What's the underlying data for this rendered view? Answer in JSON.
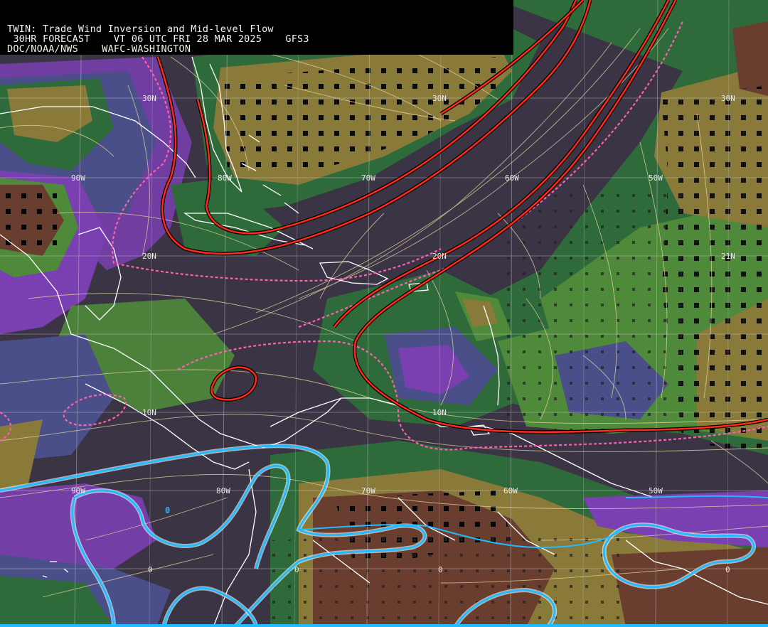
{
  "header": {
    "line1": "TWIN: Trade Wind Inversion and Mid-level Flow",
    "line2": " 30HR FORECAST    VT 06 UTC FRI 28 MAR 2025    GFS3",
    "line3": "DOC/NOAA/NWS    WAFC-WASHINGTON"
  },
  "grid_labels": {
    "lat_30": [
      "30N",
      "30N",
      "30N"
    ],
    "lat_20": [
      "20N",
      "20N",
      "21N"
    ],
    "lat_10": [
      "10N",
      "10N"
    ],
    "lon_row_top": [
      "90W",
      "80W",
      "70W",
      "60W",
      "50W"
    ],
    "lon_row_bottom": [
      "90W",
      "80W",
      "70W",
      "60W",
      "50W"
    ],
    "zero_labels": [
      "0",
      "0",
      "0",
      "0",
      "0"
    ]
  },
  "colors": {
    "header_bg": "#000000",
    "header_text": "#f2f2f2",
    "ocean_dark": "#3b3445",
    "purple": "#7a3fb0",
    "slate": "#4a4f8a",
    "green_dark": "#2f6b3a",
    "green": "#4f8a3a",
    "olive": "#8a7a3a",
    "brown": "#6a3e2e",
    "inversion_contour": "#ff2a1a",
    "dashed_contour": "#ff5fb0",
    "zero_contour": "#22bbff",
    "coastline": "#ffffff",
    "streamline": "#e8d8a0",
    "gridline": "#c8c8c8"
  }
}
